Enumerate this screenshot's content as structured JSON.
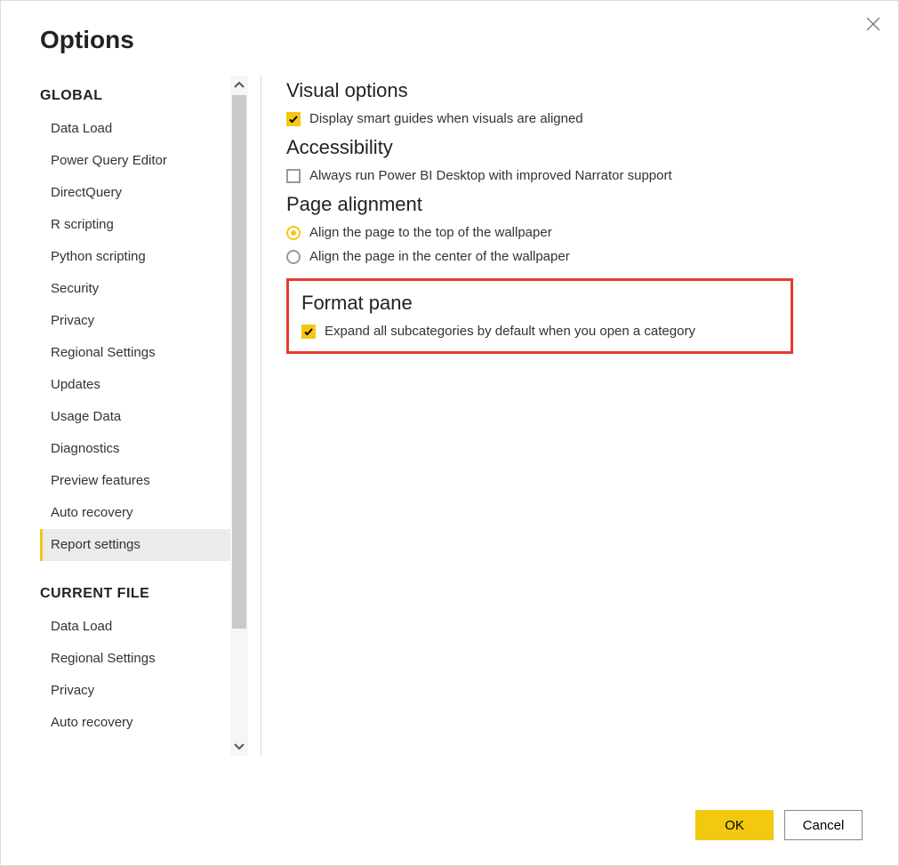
{
  "dialog": {
    "title": "Options"
  },
  "sidebar": {
    "sections": [
      {
        "header": "GLOBAL",
        "items": [
          {
            "label": "Data Load",
            "selected": false
          },
          {
            "label": "Power Query Editor",
            "selected": false
          },
          {
            "label": "DirectQuery",
            "selected": false
          },
          {
            "label": "R scripting",
            "selected": false
          },
          {
            "label": "Python scripting",
            "selected": false
          },
          {
            "label": "Security",
            "selected": false
          },
          {
            "label": "Privacy",
            "selected": false
          },
          {
            "label": "Regional Settings",
            "selected": false
          },
          {
            "label": "Updates",
            "selected": false
          },
          {
            "label": "Usage Data",
            "selected": false
          },
          {
            "label": "Diagnostics",
            "selected": false
          },
          {
            "label": "Preview features",
            "selected": false
          },
          {
            "label": "Auto recovery",
            "selected": false
          },
          {
            "label": "Report settings",
            "selected": true
          }
        ]
      },
      {
        "header": "CURRENT FILE",
        "items": [
          {
            "label": "Data Load",
            "selected": false
          },
          {
            "label": "Regional Settings",
            "selected": false
          },
          {
            "label": "Privacy",
            "selected": false
          },
          {
            "label": "Auto recovery",
            "selected": false
          }
        ]
      }
    ]
  },
  "content": {
    "visual_options": {
      "title": "Visual options",
      "smart_guides": {
        "label": "Display smart guides when visuals are aligned",
        "checked": true
      }
    },
    "accessibility": {
      "title": "Accessibility",
      "narrator": {
        "label": "Always run Power BI Desktop with improved Narrator support",
        "checked": false
      }
    },
    "page_alignment": {
      "title": "Page alignment",
      "top": {
        "label": "Align the page to the top of the wallpaper",
        "selected": true
      },
      "center": {
        "label": "Align the page in the center of the wallpaper",
        "selected": false
      }
    },
    "format_pane": {
      "title": "Format pane",
      "expand_all": {
        "label": "Expand all subcategories by default when you open a category",
        "checked": true
      }
    }
  },
  "footer": {
    "ok": "OK",
    "cancel": "Cancel"
  }
}
